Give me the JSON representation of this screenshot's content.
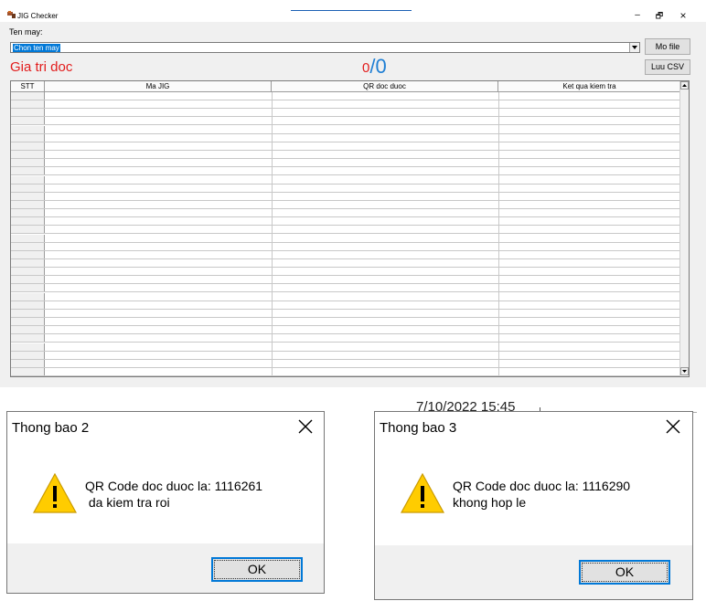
{
  "window": {
    "title": "JIG Checker",
    "controls": {
      "minimize": "–",
      "maximize": "🗗",
      "close": "×"
    }
  },
  "form": {
    "machine_label": "Ten may:",
    "machine_select_value": "Chon ten may",
    "open_file_label": "Mo file",
    "save_csv_label": "Luu CSV",
    "value_label": "Gia tri doc",
    "counter": {
      "read": "0",
      "separator": "/",
      "total": "0"
    }
  },
  "grid": {
    "columns": [
      "STT",
      "Ma JIG",
      "QR doc duoc",
      "Ket qua kiem tra"
    ],
    "empty_row_count": 34
  },
  "dialogs": [
    {
      "title": "Thong bao 2",
      "message": "QR Code doc duoc la: 1116261\n da kiem tra roi",
      "ok_label": "OK",
      "icon": "warning-icon"
    },
    {
      "title": "Thong bao 3",
      "message": "QR Code doc duoc la: 1116290\nkhong hop le",
      "ok_label": "OK",
      "icon": "warning-icon"
    }
  ],
  "background_fragment": "7/10/2022 15:45",
  "colors": {
    "accent_red": "#e21c1c",
    "accent_blue": "#1f7fd4",
    "selection_blue": "#0078d7",
    "warning_yellow": "#ffcc00"
  }
}
